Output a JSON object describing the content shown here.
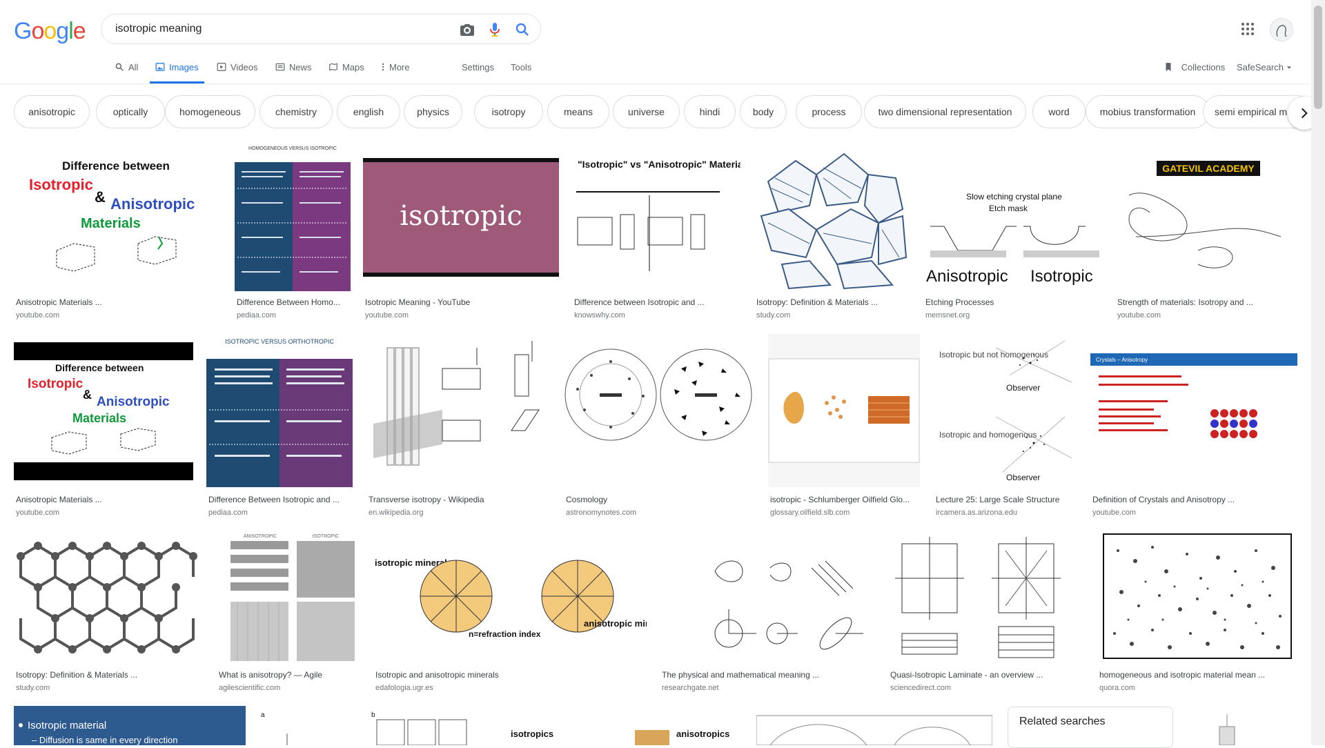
{
  "logo": {
    "letters": [
      "G",
      "o",
      "o",
      "g",
      "l",
      "e"
    ],
    "colors": [
      "#4285F4",
      "#EA4335",
      "#FBBC05",
      "#4285F4",
      "#34A853",
      "#EA4335"
    ]
  },
  "search": {
    "value": "isotropic meaning"
  },
  "tabs": [
    {
      "label": "All",
      "icon": "search-icon"
    },
    {
      "label": "Images",
      "icon": "image-icon",
      "active": true
    },
    {
      "label": "Videos",
      "icon": "play-icon"
    },
    {
      "label": "News",
      "icon": "news-icon"
    },
    {
      "label": "Maps",
      "icon": "map-icon"
    },
    {
      "label": "More",
      "icon": "more-icon"
    }
  ],
  "settings_label": "Settings",
  "tools_label": "Tools",
  "collections_label": "Collections",
  "safesearch_label": "SafeSearch",
  "chips": [
    "anisotropic",
    "optically",
    "homogeneous",
    "chemistry",
    "english",
    "physics",
    "isotropy",
    "means",
    "universe",
    "hindi",
    "body",
    "process",
    "two dimensional representation",
    "word",
    "mobius transformation",
    "semi empirical m"
  ],
  "results": [
    {
      "title": "Anisotropic Materials ...",
      "source": "youtube.com"
    },
    {
      "title": "Difference Between Homo...",
      "source": "pediaa.com"
    },
    {
      "title": "Isotropic Meaning - YouTube",
      "source": "youtube.com"
    },
    {
      "title": "Difference between Isotropic and ...",
      "source": "knowswhy.com"
    },
    {
      "title": "Isotropy: Definition & Materials ...",
      "source": "study.com"
    },
    {
      "title": "Etching Processes",
      "source": "memsnet.org"
    },
    {
      "title": "Strength of materials: Isotropy and ...",
      "source": "youtube.com"
    },
    {
      "title": "Anisotropic Materials ...",
      "source": "youtube.com"
    },
    {
      "title": "Difference Between Isotropic and ...",
      "source": "pediaa.com"
    },
    {
      "title": "Transverse isotropy - Wikipedia",
      "source": "en.wikipedia.org"
    },
    {
      "title": "Cosmology",
      "source": "astronomynotes.com"
    },
    {
      "title": "isotropic - Schlumberger Oilfield Glo...",
      "source": "glossary.oilfield.slb.com"
    },
    {
      "title": "Lecture 25: Large Scale Structure",
      "source": "ircamera.as.arizona.edu"
    },
    {
      "title": "Definition of Crystals and Anisotropy ...",
      "source": "youtube.com"
    },
    {
      "title": "Isotropy: Definition & Materials ...",
      "source": "study.com"
    },
    {
      "title": "What is anisotropy? — Agile",
      "source": "agilescientific.com"
    },
    {
      "title": "Isotropic and anisotropic minerals",
      "source": "edafologia.ugr.es"
    },
    {
      "title": "The physical and mathematical meaning ...",
      "source": "researchgate.net"
    },
    {
      "title": "Quasi-Isotropic Laminate - an overview ...",
      "source": "sciencedirect.com"
    },
    {
      "title": "homogeneous and isotropic material mean ...",
      "source": "quora.com"
    }
  ],
  "thumb_text": {
    "diff_title": "Difference   between",
    "isotropic": "Isotropic",
    "amp": "&",
    "anisotropic": "Anisotropic",
    "materials": "Materials",
    "homogeneous_versus_isotropic": "HOMOGENEOUS VERSUS ISOTROPIC",
    "isotropic_big": "isotropic",
    "iso_vs_aniso": "\"Isotropic\" vs \"Anisotropic\" Materials",
    "slow_etching": "Slow etching crystal plane",
    "etch_mask": "Etch mask",
    "gatevil": "GATEVIL ACADEMY",
    "isotropic_versus_orthotropic": "ISOTROPIC VERSUS ORTHOTROPIC",
    "crystals_anisotropy": "Crystals – Anisotropy",
    "observer": "Observer",
    "isotropic_not_homog": "Isotropic but not homogenous",
    "isotropic_and_homog": "Isotropic and homogenous",
    "isotropic_mineral": "isotropic mineral",
    "anisotropic_mineral": "anisotropic mineral",
    "refraction_index": "n=refraction index",
    "anisotropic_label": "ANISOTROPIC",
    "isotropic_label": "ISOTROPIC",
    "isotropic_material": "Isotropic material",
    "diffusion_same": "– Diffusion is same in every direction",
    "isotropics": "isotropics",
    "anisotropics": "anisotropics"
  },
  "related": {
    "title": "Related searches"
  }
}
